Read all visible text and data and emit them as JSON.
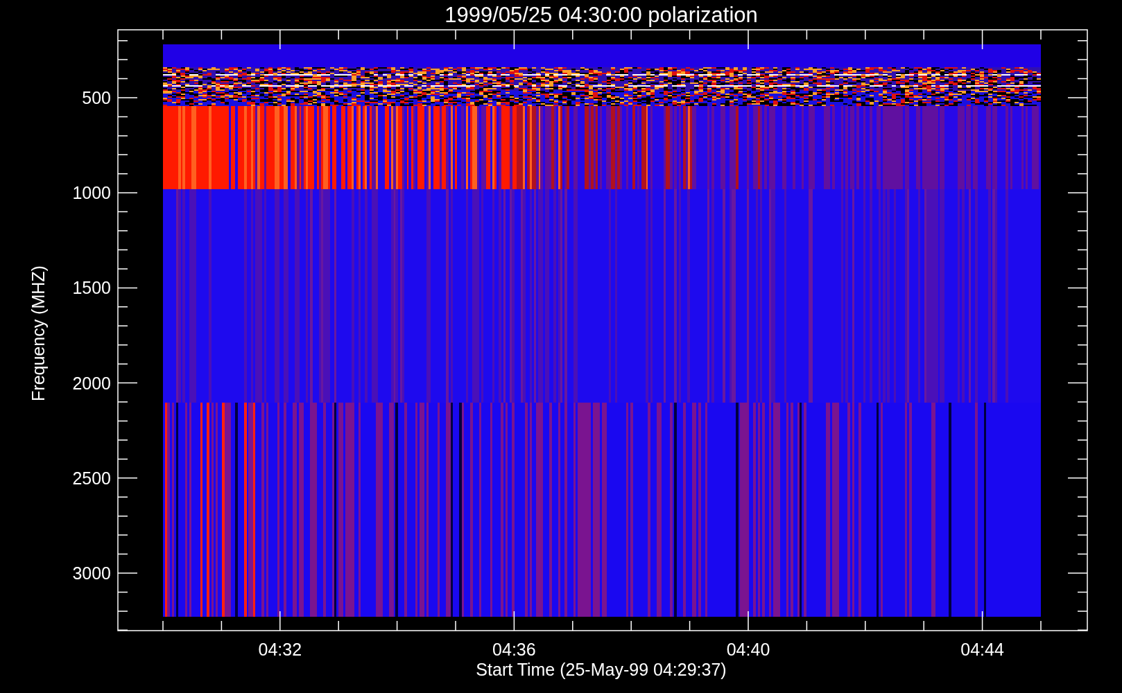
{
  "title": "1999/05/25 04:30:00 polarization",
  "y_axis": {
    "label": "Frequency (MHZ)",
    "ticks": [
      "500",
      "1000",
      "1500",
      "2000",
      "2500",
      "3000"
    ]
  },
  "x_axis": {
    "label": "Start Time (25-May-99 04:29:37)",
    "ticks": [
      "04:32",
      "04:36",
      "04:40",
      "04:44"
    ]
  }
}
